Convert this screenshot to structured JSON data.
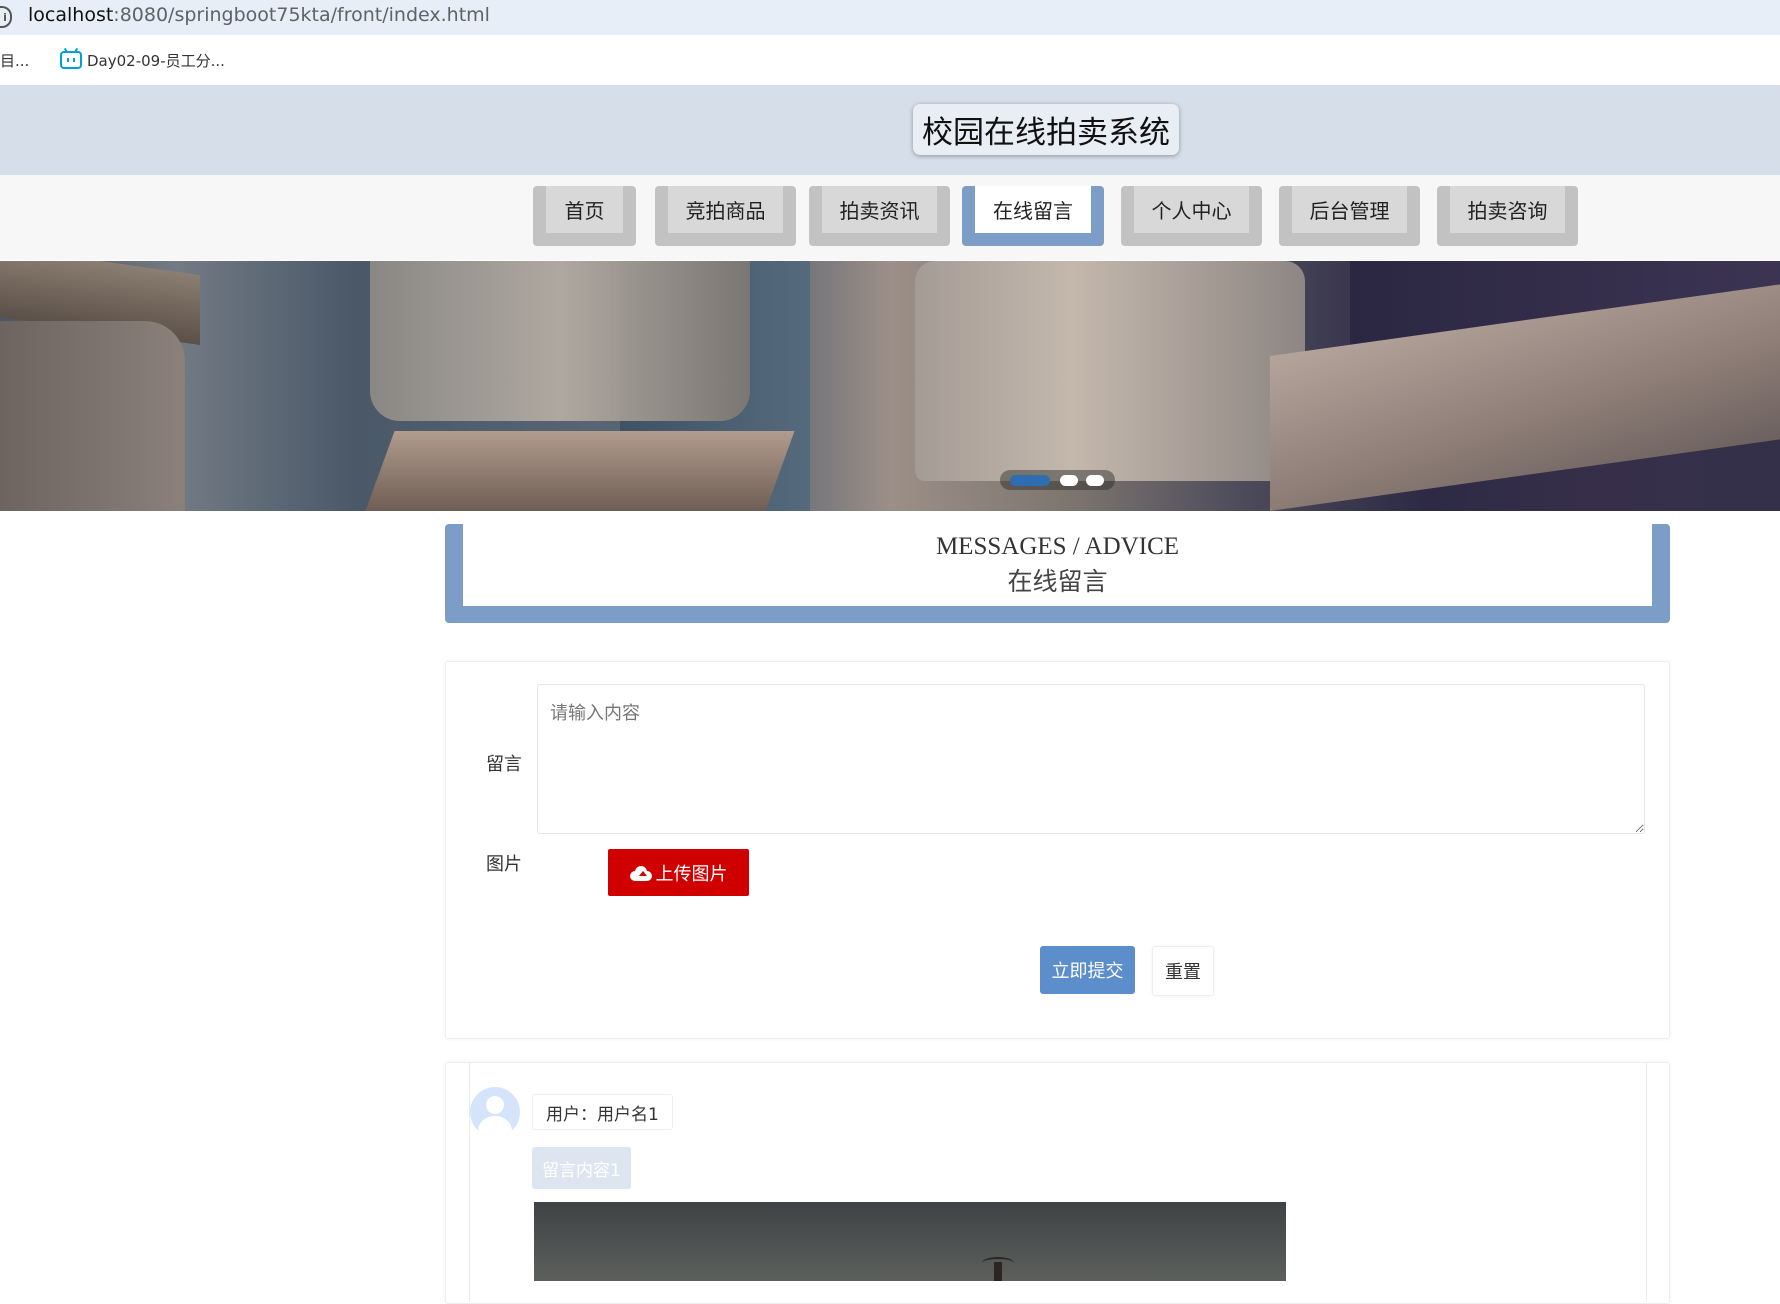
{
  "browser": {
    "url_host": "localhost",
    "url_path": ":8080/springboot75kta/front/index.html",
    "bookmarks": [
      {
        "label": "目..."
      },
      {
        "label": "Day02-09-员工分..."
      }
    ]
  },
  "header": {
    "title": "校园在线拍卖系统"
  },
  "nav": {
    "items": [
      {
        "label": "首页"
      },
      {
        "label": "竞拍商品"
      },
      {
        "label": "拍卖资讯"
      },
      {
        "label": "在线留言",
        "active": true
      },
      {
        "label": "个人中心"
      },
      {
        "label": "后台管理"
      },
      {
        "label": "拍卖咨询"
      }
    ]
  },
  "banner": {
    "slides": 3,
    "active_slide": 1
  },
  "section": {
    "title_en": "MESSAGES / ADVICE",
    "title_cn": "在线留言"
  },
  "form": {
    "message_label": "留言",
    "message_placeholder": "请输入内容",
    "message_value": "",
    "image_label": "图片",
    "upload_label": "上传图片",
    "submit_label": "立即提交",
    "reset_label": "重置"
  },
  "comments": [
    {
      "user": "用户：用户名1",
      "content": "留言内容1"
    }
  ],
  "icons": {
    "upload": "cloud-upload-icon",
    "avatar": "user-avatar-icon",
    "bookmark": "bilibili-icon",
    "site_info": "info-icon"
  },
  "colors": {
    "accent": "#7c9dc7",
    "primary_button": "#5b8ecb",
    "upload_button": "#d10000",
    "header_bg": "#d6dfe9"
  }
}
